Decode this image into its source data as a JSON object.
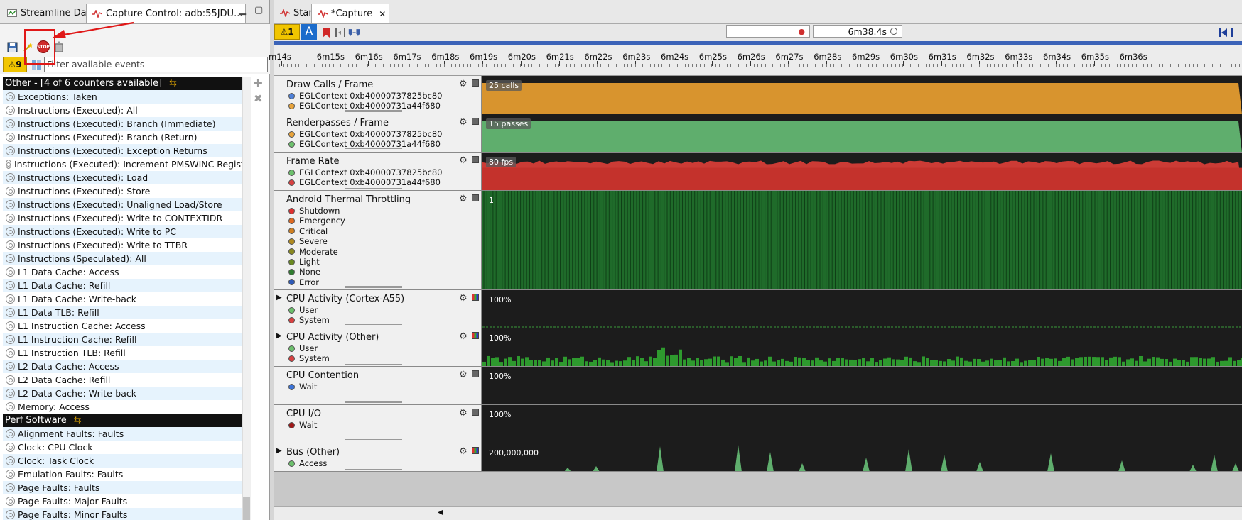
{
  "left_panel": {
    "tabs": [
      {
        "label": "Streamline Data"
      },
      {
        "label": "Capture Control: adb:55JDU..."
      }
    ],
    "window_buttons": {
      "minimize": "▁",
      "maximize": "▢"
    },
    "warning_count": "⚠9",
    "filter_placeholder": "Filter available events",
    "groups": [
      {
        "title": "Other - [4 of 6 counters available]",
        "items": [
          "Exceptions: Taken",
          "Instructions (Executed): All",
          "Instructions (Executed): Branch (Immediate)",
          "Instructions (Executed): Branch (Return)",
          "Instructions (Executed): Exception Returns",
          "Instructions (Executed): Increment PMSWINC Register",
          "Instructions (Executed): Load",
          "Instructions (Executed): Store",
          "Instructions (Executed): Unaligned Load/Store",
          "Instructions (Executed): Write to CONTEXTIDR",
          "Instructions (Executed): Write to PC",
          "Instructions (Executed): Write to TTBR",
          "Instructions (Speculated): All",
          "L1 Data Cache: Access",
          "L1 Data Cache: Refill",
          "L1 Data Cache: Write-back",
          "L1 Data TLB: Refill",
          "L1 Instruction Cache: Access",
          "L1 Instruction Cache: Refill",
          "L1 Instruction TLB: Refill",
          "L2 Data Cache: Access",
          "L2 Data Cache: Refill",
          "L2 Data Cache: Write-back",
          "Memory: Access"
        ]
      },
      {
        "title": "Perf Software",
        "items": [
          "Alignment Faults: Faults",
          "Clock: CPU Clock",
          "Clock: Task Clock",
          "Emulation Faults: Faults",
          "Page Faults: Faults",
          "Page Faults: Major Faults",
          "Page Faults: Minor Faults"
        ]
      }
    ],
    "stop_label": "STOP",
    "side_buttons": {
      "add": "✚",
      "remove": "✖"
    }
  },
  "right_panel": {
    "tabs": [
      {
        "label": "Start"
      },
      {
        "label": "*Capture"
      }
    ],
    "close_icon": "✕",
    "warnings": "⚠1",
    "annotate_label": "A",
    "cursor_time": "6m38.4s",
    "ruler_ticks": [
      "m14s",
      "6m15s",
      "6m16s",
      "6m17s",
      "6m18s",
      "6m19s",
      "6m20s",
      "6m21s",
      "6m22s",
      "6m23s",
      "6m24s",
      "6m25s",
      "6m26s",
      "6m27s",
      "6m28s",
      "6m29s",
      "6m30s",
      "6m31s",
      "6m32s",
      "6m33s",
      "6m34s",
      "6m35s",
      "6m36s"
    ],
    "rows": [
      {
        "title": "Draw Calls / Frame",
        "expandable": false,
        "legend": [
          {
            "label": "EGLContext 0xb40000737825bc80",
            "color": "#4f81d8"
          },
          {
            "label": "EGLContext 0xb40000731a44f680",
            "color": "#e8a33a"
          }
        ],
        "value_label": "25 calls",
        "fill_color": "#d8942e",
        "fill_level": 1.0
      },
      {
        "title": "Renderpasses / Frame",
        "expandable": false,
        "legend": [
          {
            "label": "EGLContext 0xb40000737825bc80",
            "color": "#e8a33a"
          },
          {
            "label": "EGLContext 0xb40000731a44f680",
            "color": "#6cc06c"
          }
        ],
        "value_label": "15 passes",
        "fill_color": "#5fae6d",
        "fill_level": 1.0
      },
      {
        "title": "Frame Rate",
        "expandable": false,
        "legend": [
          {
            "label": "EGLContext 0xb40000737825bc80",
            "color": "#6cc06c"
          },
          {
            "label": "EGLContext 0xb40000731a44f680",
            "color": "#d84040"
          }
        ],
        "value_label": "80 fps",
        "fill_color": "#cc3b35",
        "fill_level": 0.9
      },
      {
        "title": "Android Thermal Throttling",
        "expandable": false,
        "legend": [
          {
            "label": "Shutdown",
            "color": "#e03030"
          },
          {
            "label": "Emergency",
            "color": "#e06a20"
          },
          {
            "label": "Critical",
            "color": "#d08020"
          },
          {
            "label": "Severe",
            "color": "#b08a20"
          },
          {
            "label": "Moderate",
            "color": "#8a8a20"
          },
          {
            "label": "Light",
            "color": "#6a8a20"
          },
          {
            "label": "None",
            "color": "#2e7d2e"
          },
          {
            "label": "Error",
            "color": "#2e5ab8"
          }
        ],
        "value_label": "1",
        "fill_color": "#1f6b2a",
        "fill_level": 1.0
      },
      {
        "title": "CPU Activity (Cortex-A55)",
        "expandable": true,
        "legend": [
          {
            "label": "User",
            "color": "#6cc06c"
          },
          {
            "label": "System",
            "color": "#d84040"
          }
        ],
        "value_label": "100%",
        "fill_color": "#3a9a3a",
        "fill_level": 0.0
      },
      {
        "title": "CPU Activity (Other)",
        "expandable": true,
        "legend": [
          {
            "label": "User",
            "color": "#6cc06c"
          },
          {
            "label": "System",
            "color": "#d84040"
          }
        ],
        "value_label": "100%",
        "fill_color": "#2e9a2e",
        "fill_level": 0.2
      },
      {
        "title": "CPU Contention",
        "expandable": false,
        "legend": [
          {
            "label": "Wait",
            "color": "#3b73d8"
          }
        ],
        "value_label": "100%",
        "fill_color": "#3b73d8",
        "fill_level": 0.0
      },
      {
        "title": "CPU I/O",
        "expandable": false,
        "legend": [
          {
            "label": "Wait",
            "color": "#a01818"
          }
        ],
        "value_label": "100%",
        "fill_color": "#a01818",
        "fill_level": 0.0
      },
      {
        "title": "Bus (Other)",
        "expandable": true,
        "legend": [
          {
            "label": "Access",
            "color": "#6cc06c"
          }
        ],
        "value_label": "200,000,000",
        "fill_color": "#5fae6d",
        "fill_level": 0.3
      }
    ]
  }
}
